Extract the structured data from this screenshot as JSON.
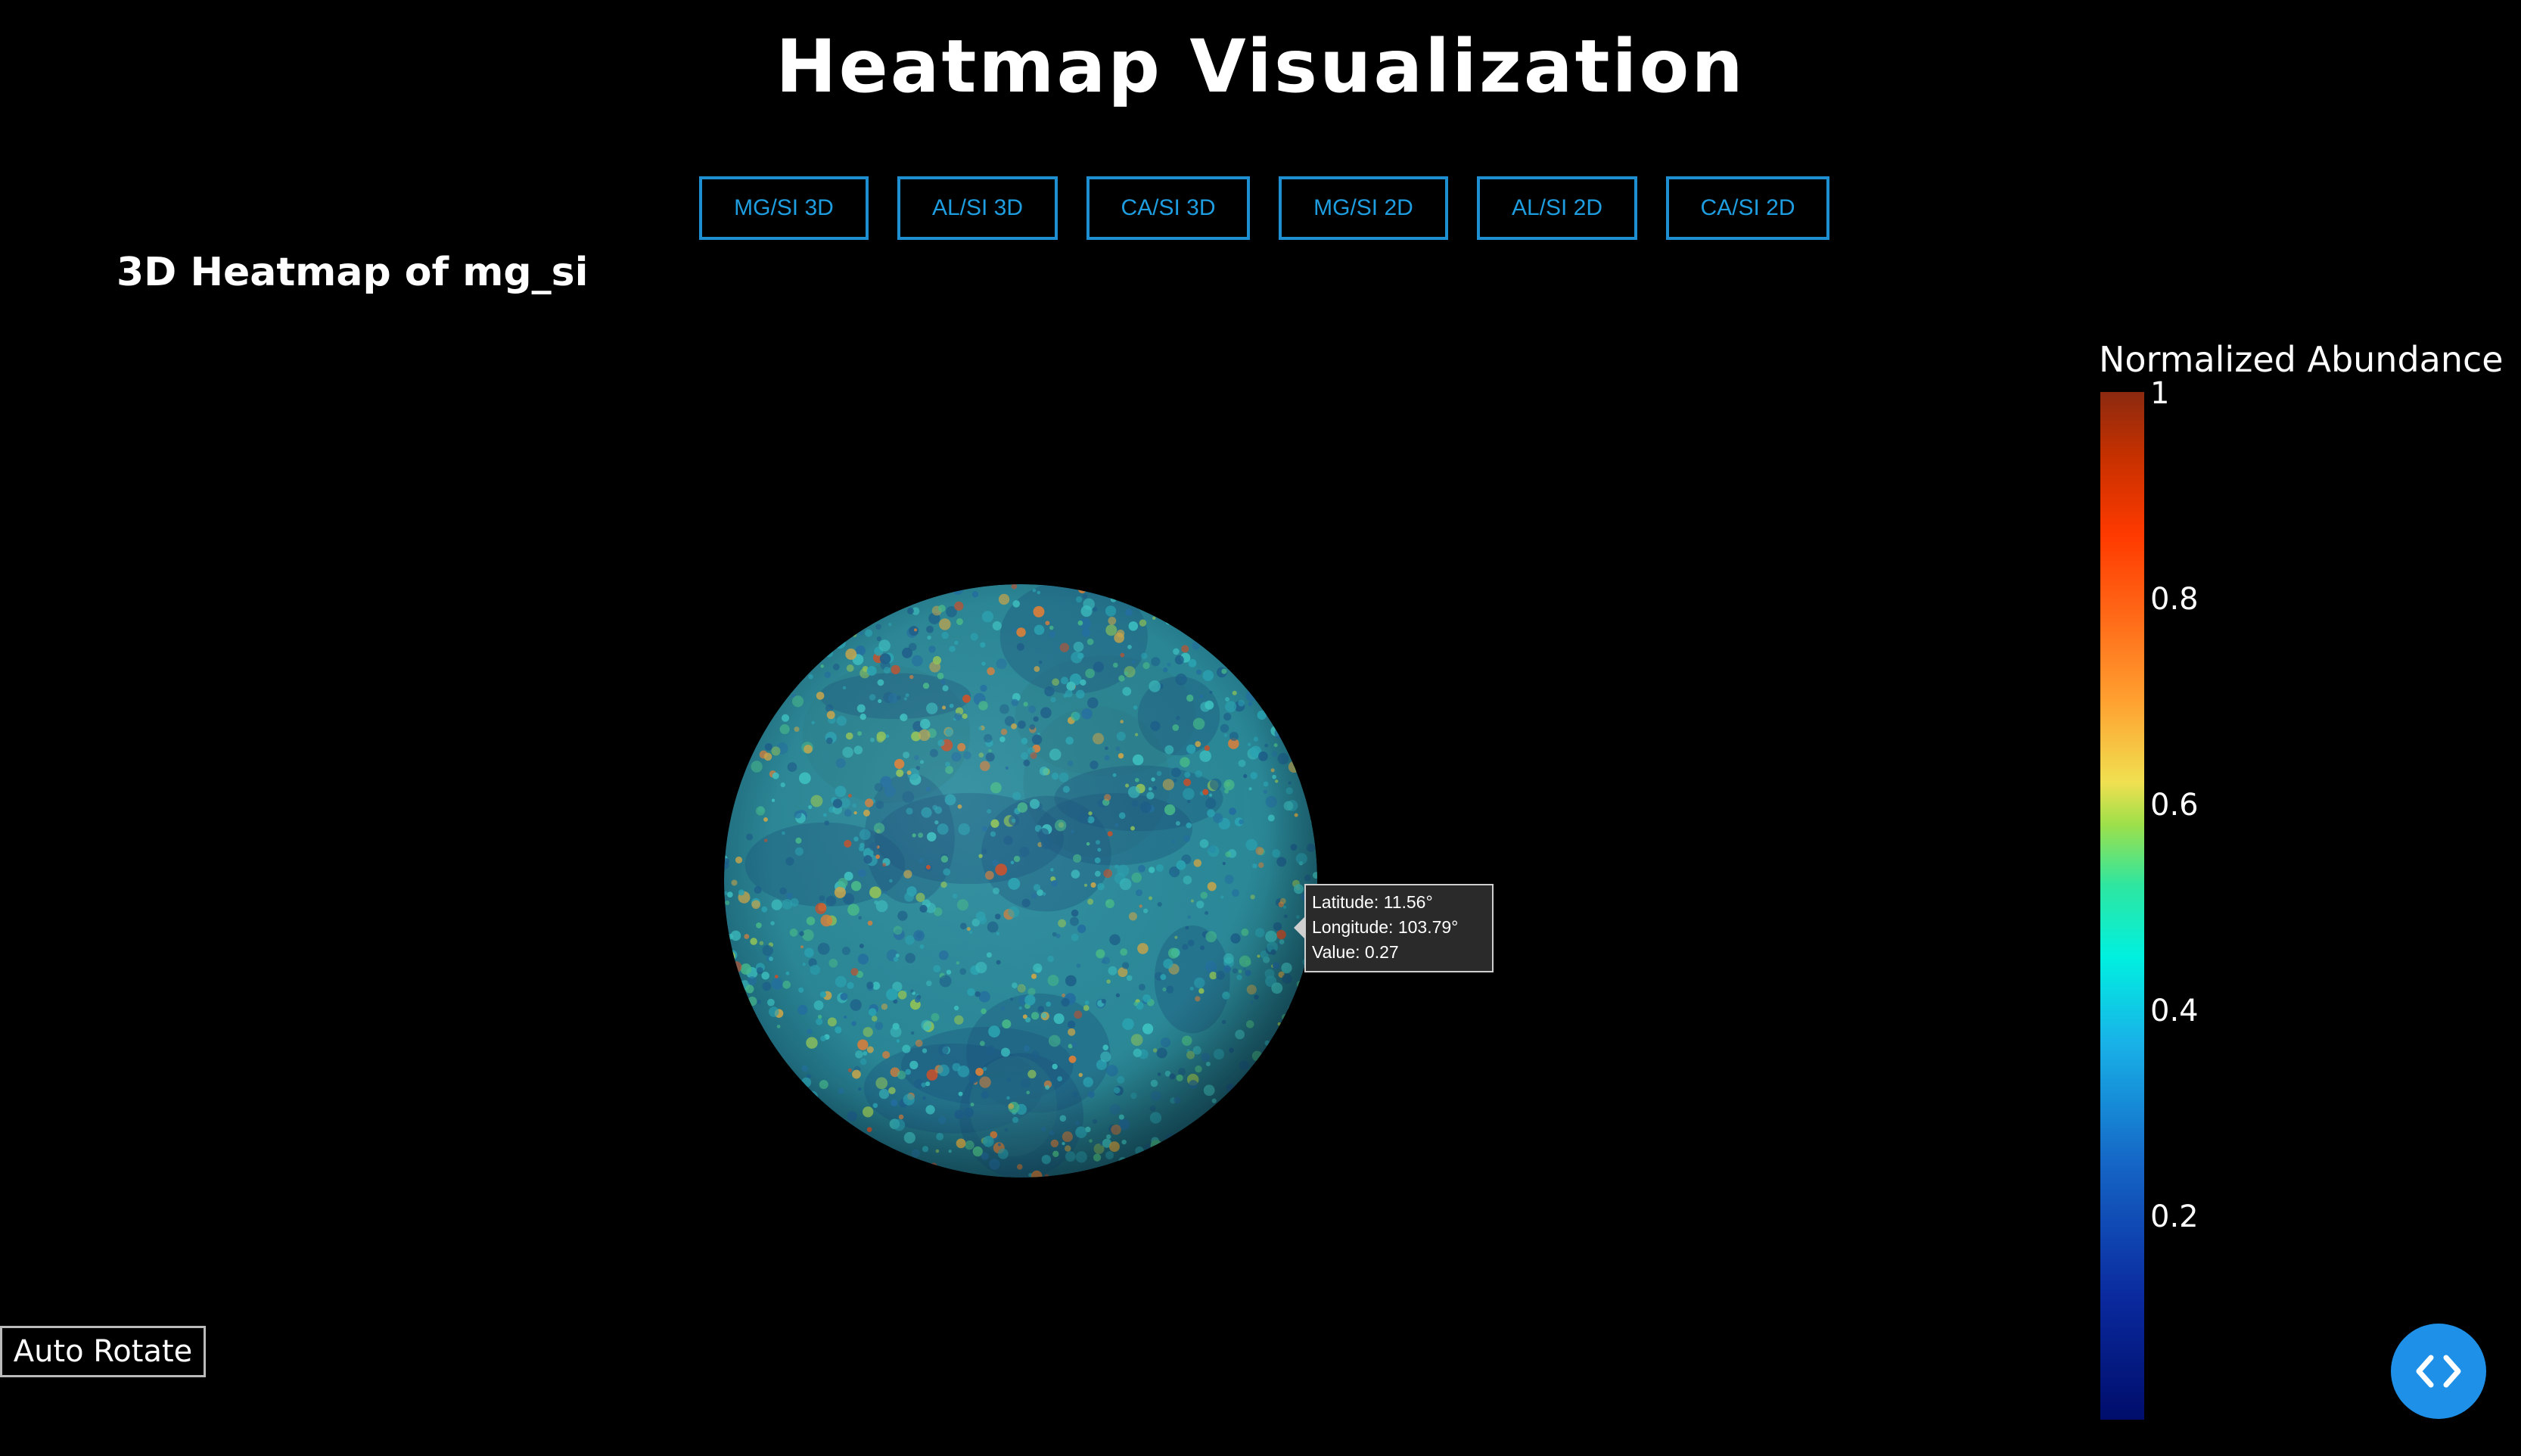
{
  "header": {
    "title": "Heatmap Visualization"
  },
  "view_buttons": [
    {
      "label": "MG/SI 3D"
    },
    {
      "label": "AL/SI 3D"
    },
    {
      "label": "CA/SI 3D"
    },
    {
      "label": "MG/SI 2D"
    },
    {
      "label": "AL/SI 2D"
    },
    {
      "label": "CA/SI 2D"
    }
  ],
  "plot": {
    "title": "3D Heatmap of mg_si"
  },
  "tooltip": {
    "latitude": "Latitude: 11.56°",
    "longitude": "Longitude: 103.79°",
    "value": "Value: 0.27"
  },
  "colorbar": {
    "title": "Normalized Abundance",
    "ticks": [
      "1",
      "0.8",
      "0.6",
      "0.4",
      "0.2"
    ],
    "colors": [
      "#000d6b",
      "#1566c6",
      "#00f0e0",
      "#f0e050",
      "#ff6a18",
      "#8b2a10"
    ]
  },
  "controls": {
    "auto_rotate_label": "Auto Rotate"
  },
  "icons": {
    "fab": "code-icon"
  },
  "colors": {
    "accent": "#1e90e8",
    "background": "#000000"
  }
}
